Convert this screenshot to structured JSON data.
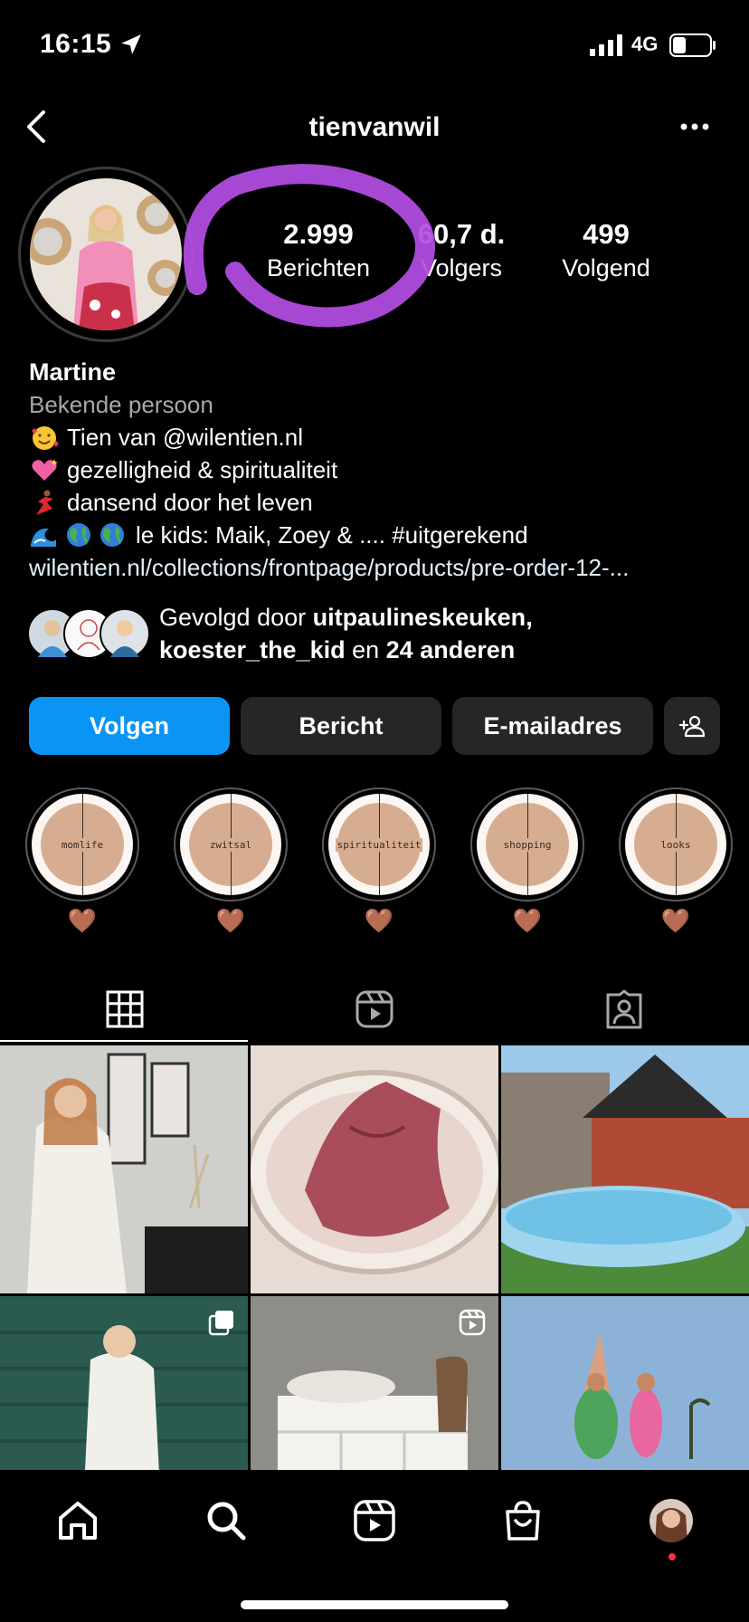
{
  "status_bar": {
    "time": "16:15",
    "network": "4G"
  },
  "header": {
    "username": "tienvanwil"
  },
  "stats": [
    {
      "value": "2.999",
      "label": "Berichten"
    },
    {
      "value": "60,7 d.",
      "label": "Volgers"
    },
    {
      "value": "499",
      "label": "Volgend"
    }
  ],
  "bio": {
    "name": "Martine",
    "category": "Bekende persoon",
    "lines": [
      {
        "emoji": "smiling-face-with-hearts-icon",
        "text": "Tien van @wilentien.nl"
      },
      {
        "emoji": "sparkling-heart-icon",
        "text": "gezelligheid & spiritualiteit"
      },
      {
        "emoji": "dancer-icon",
        "text": "dansend door het leven"
      },
      {
        "emoji": "wave-earth-icons",
        "text": "le kids: Maik, Zoey & .... #uitgerekend"
      }
    ],
    "link": "wilentien.nl/collections/frontpage/products/pre-order-12-..."
  },
  "followed_by": {
    "prefix": "Gevolgd door ",
    "user1": "uitpaulineskeuken",
    "sep": ",",
    "user2": "koester_the_kid",
    "middle": " en ",
    "others": "24 anderen"
  },
  "buttons": {
    "follow": "Volgen",
    "message": "Bericht",
    "email": "E-mailadres"
  },
  "highlights": [
    {
      "title": "momlife",
      "label": "🤎"
    },
    {
      "title": "zwitsal",
      "label": "🤎"
    },
    {
      "title": "spiritualiteit",
      "label": "🤎"
    },
    {
      "title": "shopping",
      "label": "🤎"
    },
    {
      "title": "looks",
      "label": "🤎"
    }
  ],
  "colors": {
    "accent": "#0a95f6",
    "button_bg": "#262626",
    "scribble": "#b44ee6",
    "highlight_bg": "#d7ad91"
  }
}
